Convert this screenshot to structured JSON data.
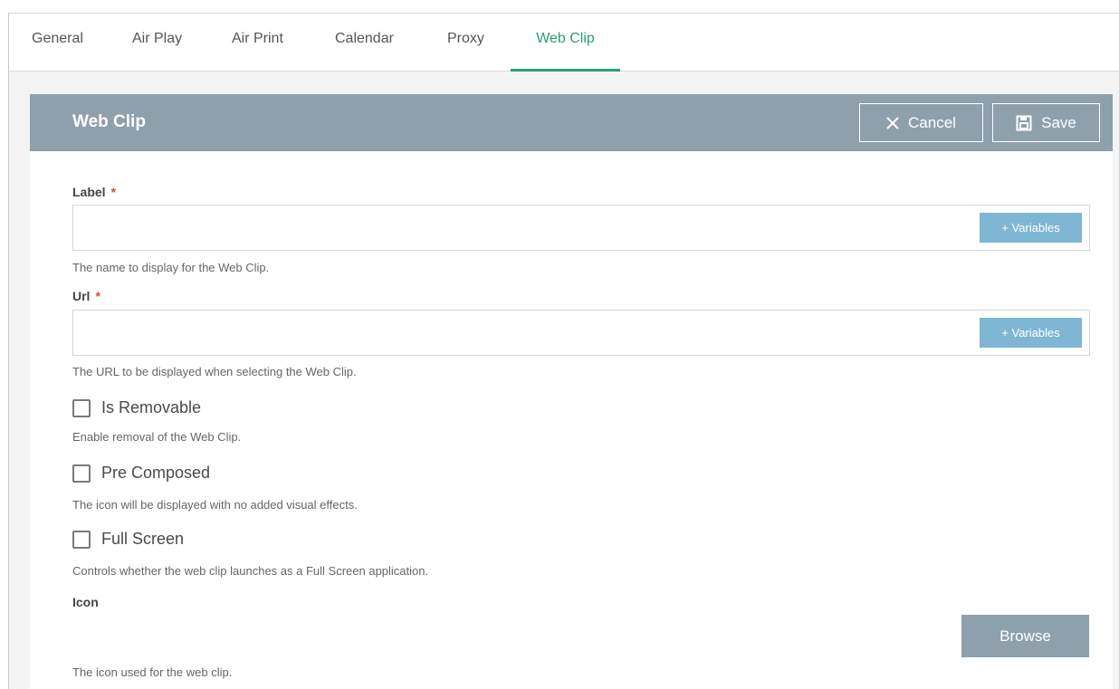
{
  "tabs": [
    {
      "label": "General",
      "active": false
    },
    {
      "label": "Air Play",
      "active": false
    },
    {
      "label": "Air Print",
      "active": false
    },
    {
      "label": "Calendar",
      "active": false
    },
    {
      "label": "Proxy",
      "active": false
    },
    {
      "label": "Web Clip",
      "active": true
    }
  ],
  "panel": {
    "title": "Web Clip",
    "cancel_label": "Cancel",
    "save_label": "Save"
  },
  "form": {
    "label": {
      "label": "Label",
      "required": "*",
      "value": "",
      "variables_label": "+ Variables",
      "help": "The name to display for the Web Clip."
    },
    "url": {
      "label": "Url",
      "required": "*",
      "value": "",
      "variables_label": "+ Variables",
      "help": "The URL to be displayed when selecting the Web Clip."
    },
    "is_removable": {
      "label": "Is Removable",
      "checked": false,
      "help": "Enable removal of the Web Clip."
    },
    "pre_composed": {
      "label": "Pre Composed",
      "checked": false,
      "help": "The icon will be displayed with no added visual effects."
    },
    "full_screen": {
      "label": "Full Screen",
      "checked": false,
      "help": "Controls whether the web clip launches as a Full Screen application."
    },
    "icon": {
      "label": "Icon",
      "browse_label": "Browse",
      "help": "The icon used for the web clip."
    }
  },
  "colors": {
    "accent": "#26a07a",
    "header_bg": "#8fa0ad",
    "variables_bg": "#7fb6d3",
    "required": "#e04545"
  },
  "icons": {
    "cancel": "close-icon",
    "save": "floppy-disk-icon"
  }
}
